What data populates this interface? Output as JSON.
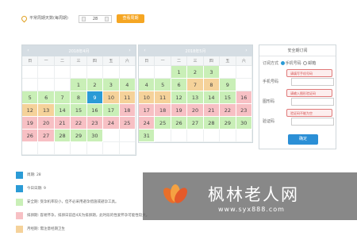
{
  "topbar": {
    "label": "平常周期天数(每周期)",
    "cycle_value": "28",
    "apply_label": "查看周期"
  },
  "calendars": [
    {
      "title": "2018年4月",
      "weekdays": [
        "日",
        "一",
        "二",
        "三",
        "四",
        "五",
        "六"
      ],
      "cells": [
        {
          "d": "",
          "s": "empty"
        },
        {
          "d": "",
          "s": "empty"
        },
        {
          "d": "",
          "s": "empty"
        },
        {
          "d": "",
          "s": "empty"
        },
        {
          "d": "",
          "s": "empty"
        },
        {
          "d": "",
          "s": "empty"
        },
        {
          "d": "",
          "s": "empty"
        },
        {
          "d": "",
          "s": "empty"
        },
        {
          "d": "",
          "s": "empty"
        },
        {
          "d": "",
          "s": "empty"
        },
        {
          "d": "1",
          "s": "safe"
        },
        {
          "d": "2",
          "s": "safe"
        },
        {
          "d": "3",
          "s": "safe"
        },
        {
          "d": "4",
          "s": "safe"
        },
        {
          "d": "5",
          "s": "safe"
        },
        {
          "d": "6",
          "s": "safe"
        },
        {
          "d": "7",
          "s": "safe"
        },
        {
          "d": "8",
          "s": "safe"
        },
        {
          "d": "9",
          "s": "today"
        },
        {
          "d": "10",
          "s": "predict"
        },
        {
          "d": "11",
          "s": "predict"
        },
        {
          "d": "12",
          "s": "predict"
        },
        {
          "d": "13",
          "s": "predict"
        },
        {
          "d": "14",
          "s": "safe"
        },
        {
          "d": "15",
          "s": "safe"
        },
        {
          "d": "16",
          "s": "safe"
        },
        {
          "d": "17",
          "s": "safe"
        },
        {
          "d": "18",
          "s": "ovu"
        },
        {
          "d": "19",
          "s": "ovu"
        },
        {
          "d": "20",
          "s": "ovu"
        },
        {
          "d": "21",
          "s": "ovu"
        },
        {
          "d": "22",
          "s": "ovu"
        },
        {
          "d": "23",
          "s": "ovu"
        },
        {
          "d": "24",
          "s": "ovu"
        },
        {
          "d": "25",
          "s": "ovu"
        },
        {
          "d": "26",
          "s": "ovu"
        },
        {
          "d": "27",
          "s": "ovu"
        },
        {
          "d": "28",
          "s": "safe"
        },
        {
          "d": "29",
          "s": "safe"
        },
        {
          "d": "30",
          "s": "safe"
        },
        {
          "d": "",
          "s": "empty"
        },
        {
          "d": "",
          "s": "empty"
        },
        {
          "d": "",
          "s": "empty"
        },
        {
          "d": "",
          "s": "empty"
        },
        {
          "d": "",
          "s": "empty"
        },
        {
          "d": "",
          "s": "empty"
        },
        {
          "d": "",
          "s": "empty"
        },
        {
          "d": "",
          "s": "empty"
        },
        {
          "d": "",
          "s": "empty"
        }
      ]
    },
    {
      "title": "2018年5月",
      "weekdays": [
        "日",
        "一",
        "二",
        "三",
        "四",
        "五",
        "六"
      ],
      "cells": [
        {
          "d": "",
          "s": "empty"
        },
        {
          "d": "",
          "s": "empty"
        },
        {
          "d": "1",
          "s": "safe"
        },
        {
          "d": "2",
          "s": "safe"
        },
        {
          "d": "3",
          "s": "safe"
        },
        {
          "d": "",
          "s": "empty"
        },
        {
          "d": "",
          "s": "empty"
        },
        {
          "d": "4",
          "s": "safe"
        },
        {
          "d": "5",
          "s": "safe"
        },
        {
          "d": "6",
          "s": "safe"
        },
        {
          "d": "7",
          "s": "predict"
        },
        {
          "d": "8",
          "s": "predict"
        },
        {
          "d": "9",
          "s": "safe"
        },
        {
          "d": "",
          "s": "empty"
        },
        {
          "d": "10",
          "s": "predict"
        },
        {
          "d": "11",
          "s": "predict"
        },
        {
          "d": "12",
          "s": "safe"
        },
        {
          "d": "13",
          "s": "safe"
        },
        {
          "d": "14",
          "s": "safe"
        },
        {
          "d": "15",
          "s": "safe"
        },
        {
          "d": "16",
          "s": "ovu"
        },
        {
          "d": "17",
          "s": "ovu"
        },
        {
          "d": "18",
          "s": "ovu"
        },
        {
          "d": "19",
          "s": "ovu"
        },
        {
          "d": "20",
          "s": "ovu"
        },
        {
          "d": "21",
          "s": "ovu"
        },
        {
          "d": "22",
          "s": "ovu"
        },
        {
          "d": "23",
          "s": "ovu"
        },
        {
          "d": "24",
          "s": "ovu"
        },
        {
          "d": "25",
          "s": "safe"
        },
        {
          "d": "26",
          "s": "safe"
        },
        {
          "d": "27",
          "s": "safe"
        },
        {
          "d": "28",
          "s": "safe"
        },
        {
          "d": "29",
          "s": "safe"
        },
        {
          "d": "30",
          "s": "safe"
        },
        {
          "d": "31",
          "s": "safe"
        },
        {
          "d": "",
          "s": "empty"
        },
        {
          "d": "",
          "s": "empty"
        },
        {
          "d": "",
          "s": "empty"
        },
        {
          "d": "",
          "s": "empty"
        },
        {
          "d": "",
          "s": "empty"
        },
        {
          "d": "",
          "s": "empty"
        }
      ]
    }
  ],
  "panel": {
    "title": "安全期订阅",
    "method_label": "订阅方式",
    "opt_phone": "手机号码",
    "opt_email": "邮箱",
    "phone_label": "手机号码",
    "phone_tip": "请填写手机号码",
    "captcha_label": "图形码",
    "captcha_tip": "请输入图形验证码",
    "sms_label": "验证码",
    "sms_tip": "验证码不能为空",
    "submit_label": "确定"
  },
  "legend": [
    {
      "color": "#2b9bd6",
      "text": "周期: 28"
    },
    {
      "color": "#2b9bd6",
      "text": "今日日期: 9"
    },
    {
      "color": "#c9efb7",
      "text": "安全期: 受孕机率较小，但不必采用避孕措施或避孕工具。"
    },
    {
      "color": "#f7c0c4",
      "text": "排卵期: 容易怀孕，排卵日前后4天为排卵期，此时段的性爱怀孕可能性较大。"
    },
    {
      "color": "#f5d29a",
      "text": "月经期: 需注意经期卫生"
    }
  ],
  "watermark": {
    "name": "枫林老人网",
    "url": "www.syx888.com"
  }
}
